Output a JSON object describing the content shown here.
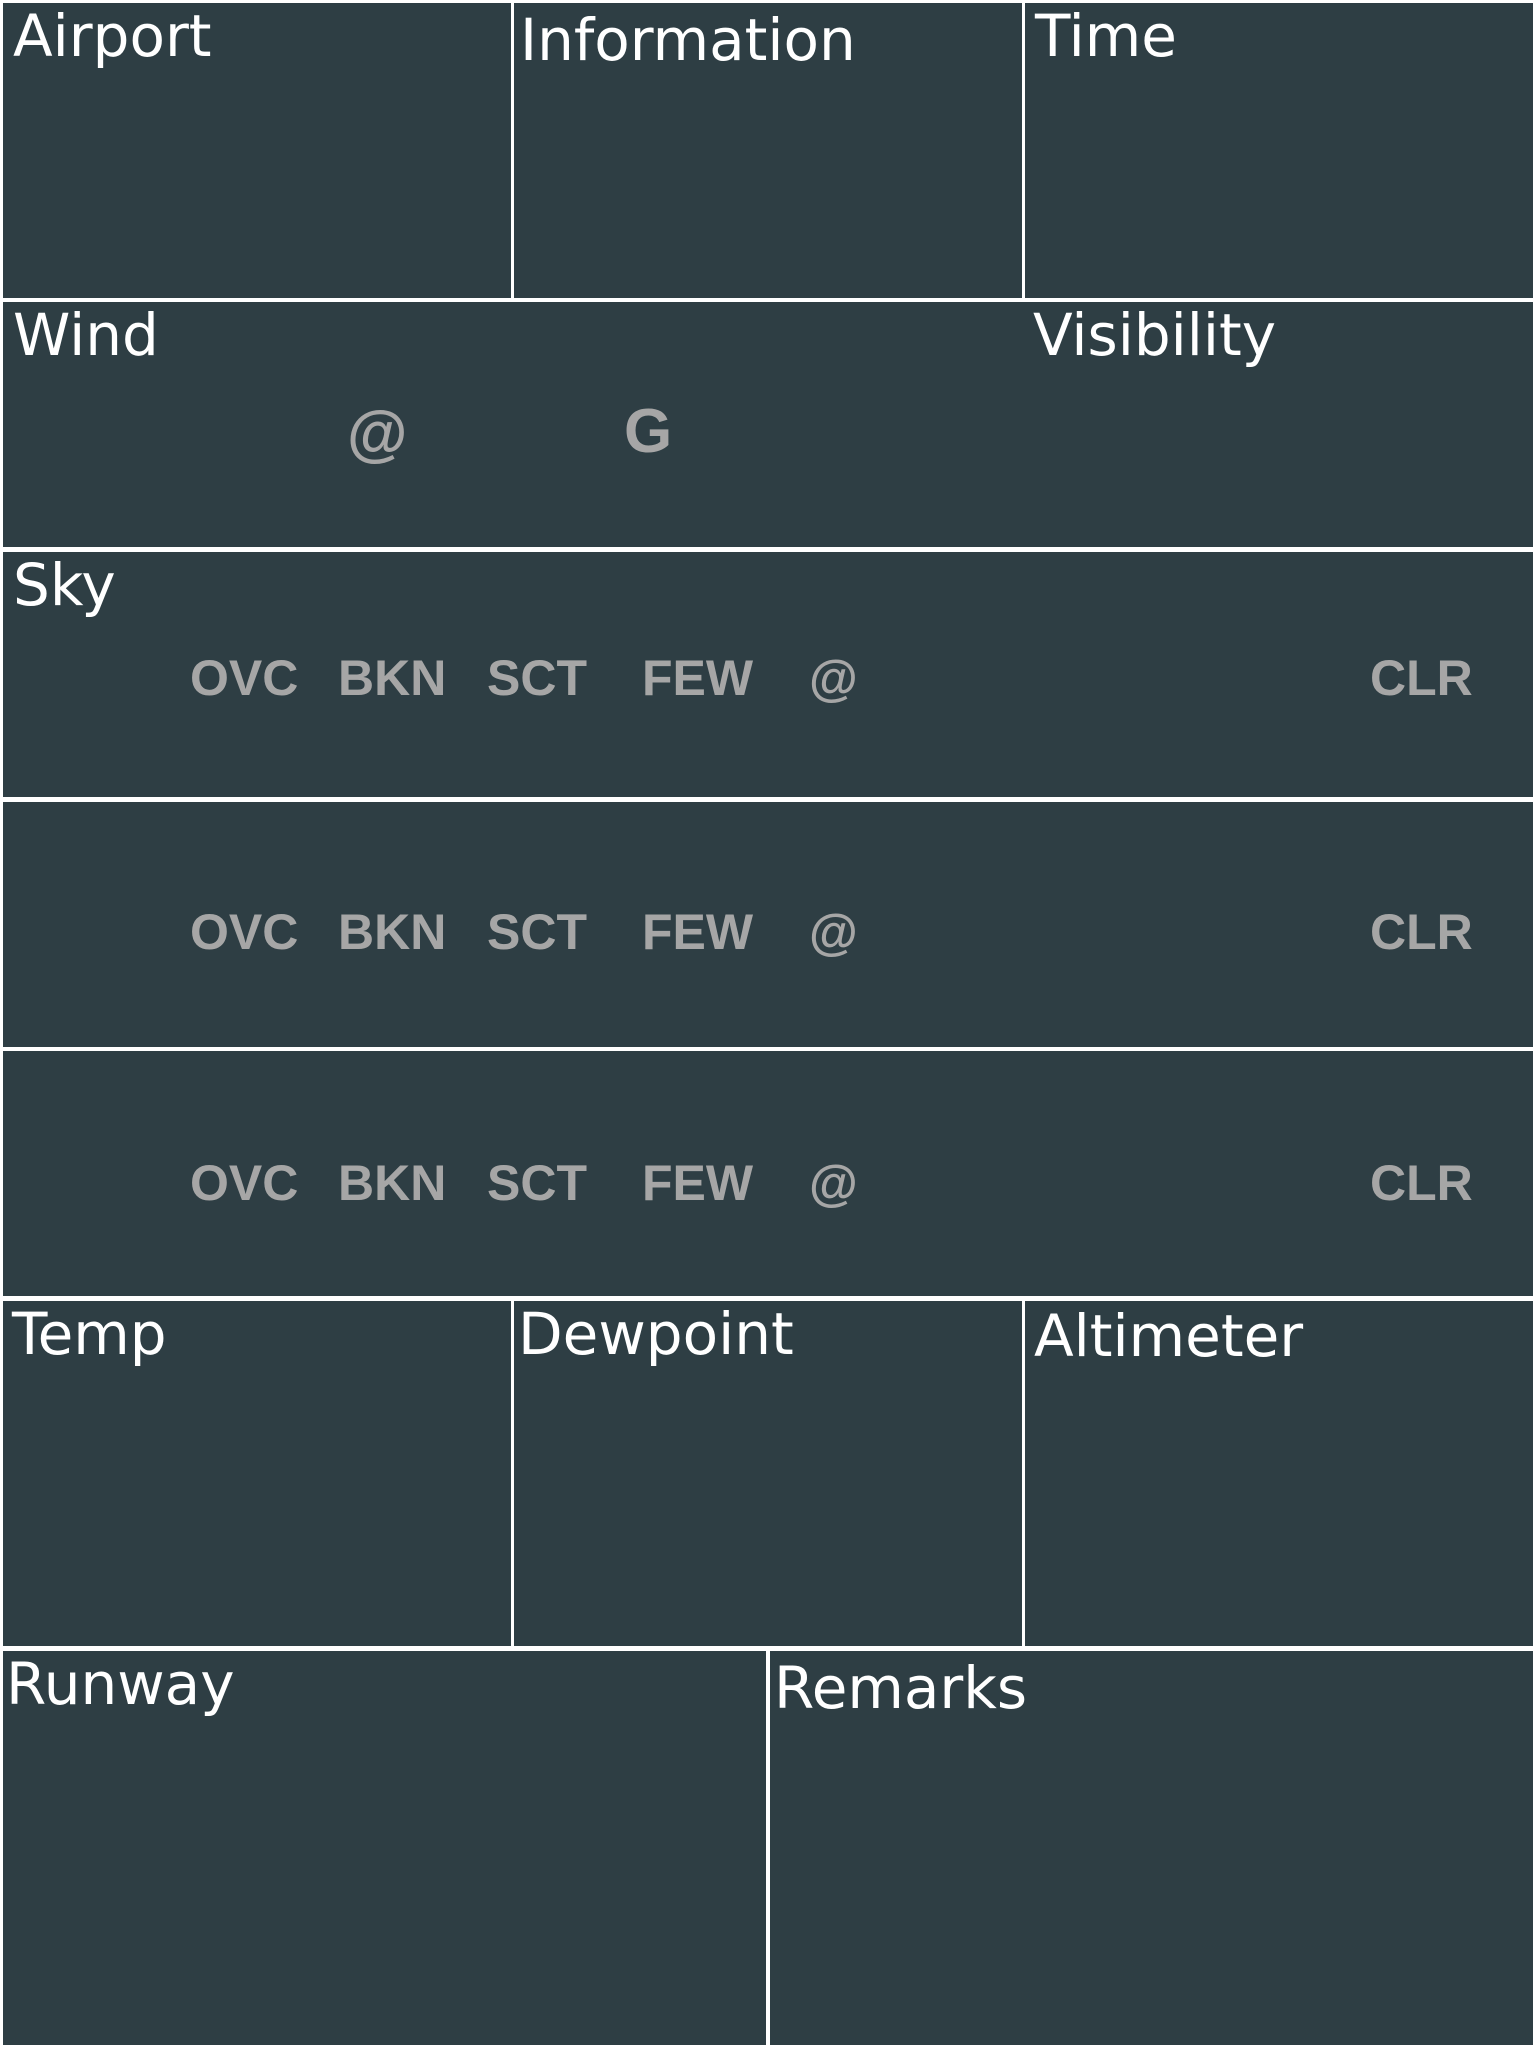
{
  "colors": {
    "panel": "#2e3e44",
    "grid_line": "#ffffff",
    "label_text": "#ffffff",
    "option_text": "#a6a6a6"
  },
  "labels": {
    "airport": "Airport",
    "information": "Information",
    "time": "Time",
    "wind": "Wind",
    "visibility": "Visibility",
    "sky": "Sky",
    "temp": "Temp",
    "dewpoint": "Dewpoint",
    "altimeter": "Altimeter",
    "runway": "Runway",
    "remarks": "Remarks"
  },
  "wind": {
    "at": "@",
    "gust": "G"
  },
  "sky_rows": [
    {
      "ovc": "OVC",
      "bkn": "BKN",
      "sct": "SCT",
      "few": "FEW",
      "at": "@",
      "clr": "CLR"
    },
    {
      "ovc": "OVC",
      "bkn": "BKN",
      "sct": "SCT",
      "few": "FEW",
      "at": "@",
      "clr": "CLR"
    },
    {
      "ovc": "OVC",
      "bkn": "BKN",
      "sct": "SCT",
      "few": "FEW",
      "at": "@",
      "clr": "CLR"
    }
  ]
}
